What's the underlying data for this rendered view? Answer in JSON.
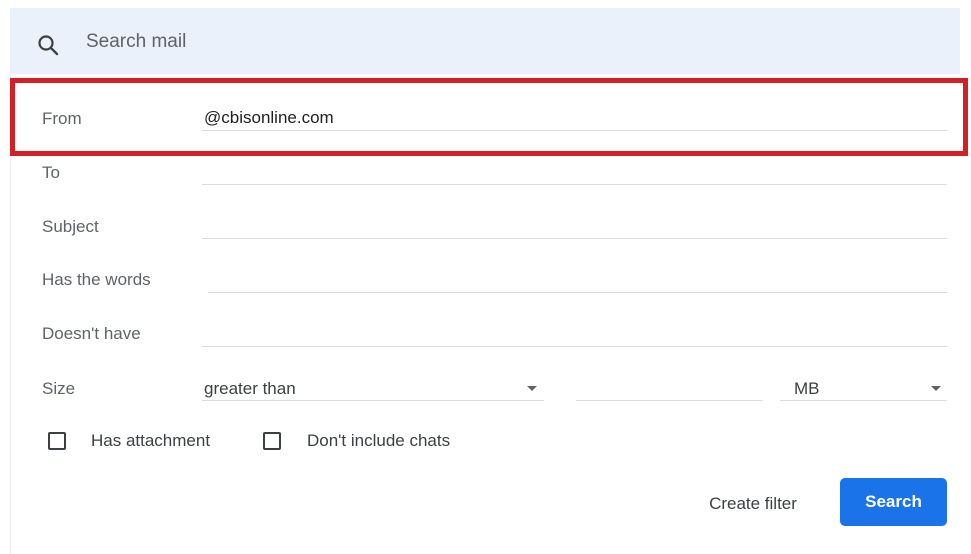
{
  "search": {
    "placeholder": "Search mail",
    "icon": "search-icon"
  },
  "fields": {
    "from": {
      "label": "From",
      "value": "@cbisonline.com"
    },
    "to": {
      "label": "To",
      "value": ""
    },
    "subject": {
      "label": "Subject",
      "value": ""
    },
    "has_words": {
      "label": "Has the words",
      "value": ""
    },
    "doesnt_have": {
      "label": "Doesn't have",
      "value": ""
    }
  },
  "size": {
    "label": "Size",
    "operator": "greater than",
    "amount": "",
    "unit": "MB"
  },
  "checkboxes": {
    "has_attachment": {
      "label": "Has attachment",
      "checked": false
    },
    "dont_include_chats": {
      "label": "Don't include chats",
      "checked": false
    }
  },
  "buttons": {
    "create_filter": "Create filter",
    "search": "Search"
  },
  "colors": {
    "primary": "#1a73e8",
    "highlight": "#d32027",
    "search_bar_bg": "#eaf1fb"
  }
}
